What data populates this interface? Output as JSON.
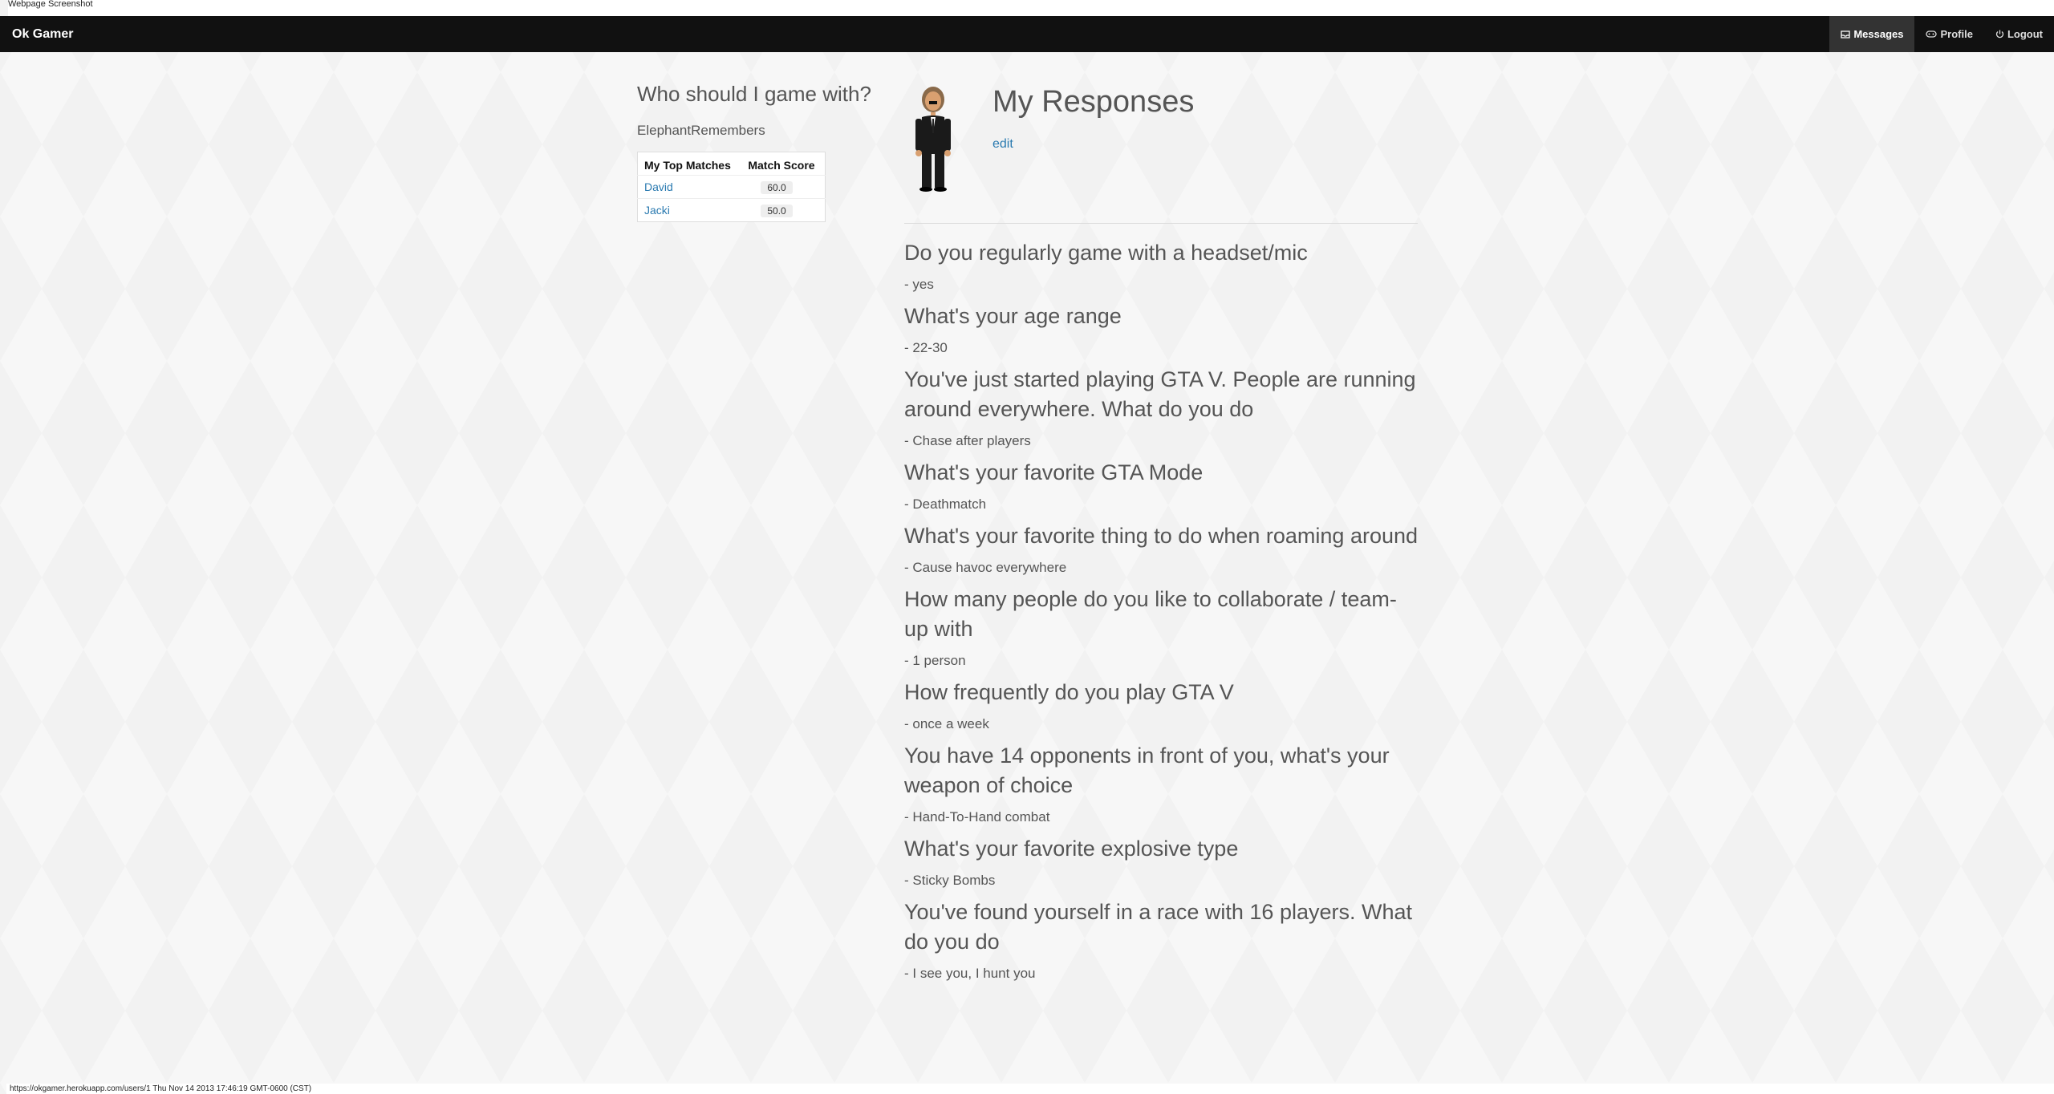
{
  "caption": "Webpage Screenshot",
  "navbar": {
    "brand": "Ok Gamer",
    "items": [
      {
        "label": "Messages",
        "icon": "inbox-icon"
      },
      {
        "label": "Profile",
        "icon": "gamepad-icon"
      },
      {
        "label": "Logout",
        "icon": "power-icon"
      }
    ]
  },
  "sidebar": {
    "title": "Who should I game with?",
    "username": "ElephantRemembers",
    "table": {
      "headers": [
        "My Top Matches",
        "Match Score"
      ],
      "rows": [
        {
          "name": "David",
          "score": "60.0"
        },
        {
          "name": "Jacki",
          "score": "50.0"
        }
      ]
    }
  },
  "main": {
    "title": "My Responses",
    "edit_label": "edit",
    "responses": [
      {
        "q": "Do you regularly game with a headset/mic",
        "a": "- yes"
      },
      {
        "q": "What's your age range",
        "a": "- 22-30"
      },
      {
        "q": "You've just started playing GTA V. People are running around everywhere. What do you do",
        "a": "- Chase after players"
      },
      {
        "q": "What's your favorite GTA Mode",
        "a": "- Deathmatch"
      },
      {
        "q": "What's your favorite thing to do when roaming around",
        "a": "- Cause havoc everywhere"
      },
      {
        "q": "How many people do you like to collaborate / team-up with",
        "a": "- 1 person"
      },
      {
        "q": "How frequently do you play GTA V",
        "a": "- once a week"
      },
      {
        "q": "You have 14 opponents in front of you, what's your weapon of choice",
        "a": "- Hand-To-Hand combat"
      },
      {
        "q": "What's your favorite explosive type",
        "a": "- Sticky Bombs"
      },
      {
        "q": "You've found yourself in a race with 16 players. What do you do",
        "a": "- I see you, I hunt you"
      }
    ]
  },
  "statusbar": "https://okgamer.herokuapp.com/users/1 Thu Nov 14 2013 17:46:19 GMT-0600 (CST)"
}
